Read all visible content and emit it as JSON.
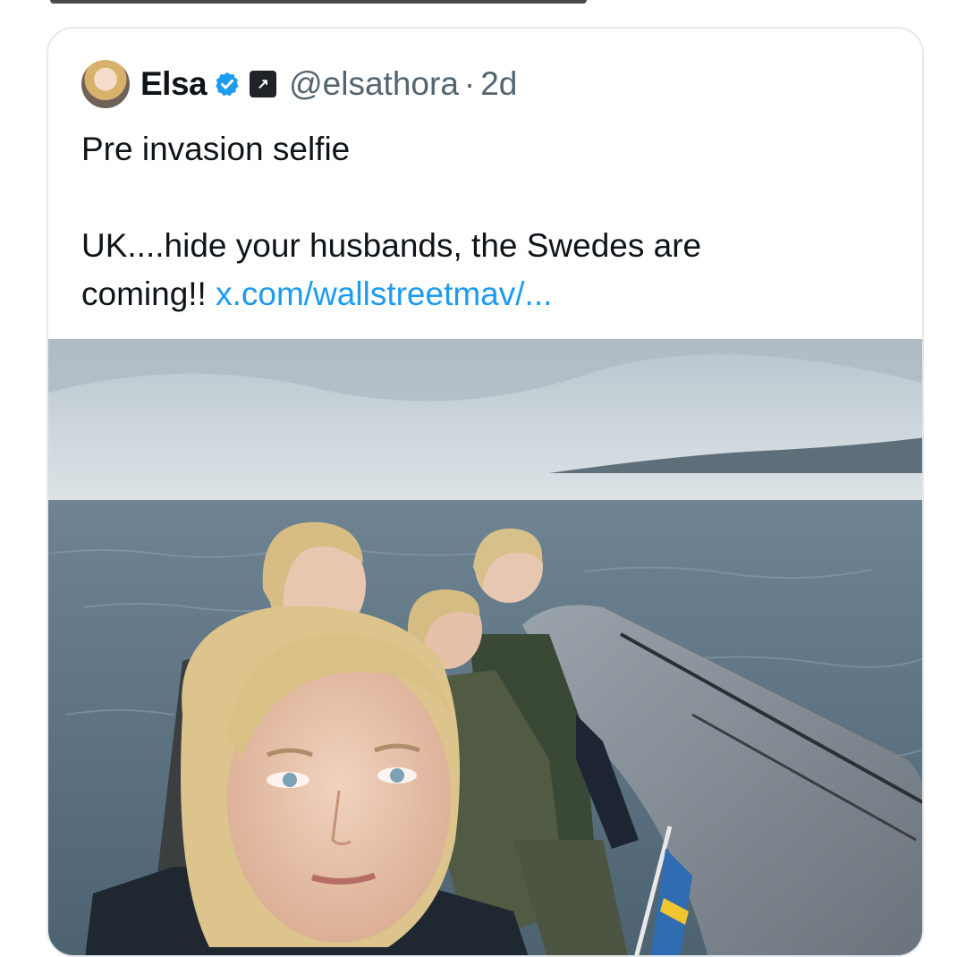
{
  "tweet": {
    "author_name": "Elsa",
    "handle": "@elsathora",
    "separator": "·",
    "age": "2d",
    "line1": "Pre invasion selfie",
    "line2": "UK....hide your husbands, the Swedes are",
    "line3": "coming!!",
    "link_text": "x.com/wallstreetmav/...",
    "affiliate_badge": "↗",
    "icons": {
      "verified": "verified-badge-icon",
      "affiliate": "affiliate-badge-icon"
    },
    "colors": {
      "text": "#0f1419",
      "muted": "#536471",
      "link": "#1d9bf0",
      "verified": "#1d9bf0"
    }
  }
}
